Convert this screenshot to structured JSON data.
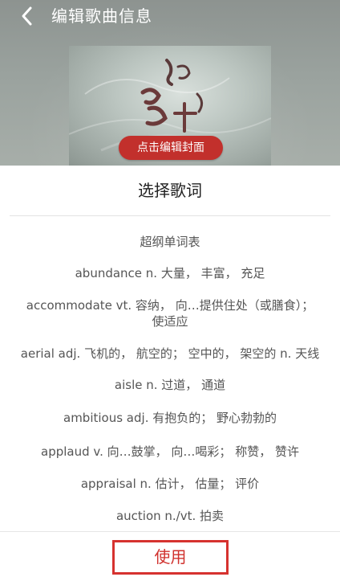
{
  "header": {
    "title": "编辑歌曲信息",
    "back_icon": "chevron-left-icon"
  },
  "cover": {
    "edit_label": "点击编辑封面"
  },
  "lyrics_sheet": {
    "title": "选择歌词",
    "lines": [
      "超纲单词表",
      "abundance n. 大量， 丰富， 充足",
      "accommodate vt. 容纳， 向…提供住处（或膳食）；\n使适应",
      "aerial adj. 飞机的， 航空的； 空中的， 架空的 n. 天线",
      "aisle n. 过道， 通道",
      "ambitious adj. 有抱负的； 野心勃勃的",
      "applaud v. 向…鼓掌， 向…喝彩； 称赞， 赞许",
      "appraisal n. 估计， 估量； 评价",
      "auction n./vt. 拍卖"
    ],
    "use_button": "使用"
  },
  "colors": {
    "accent_red": "#d0312d",
    "pill_red": "#c2302c"
  }
}
